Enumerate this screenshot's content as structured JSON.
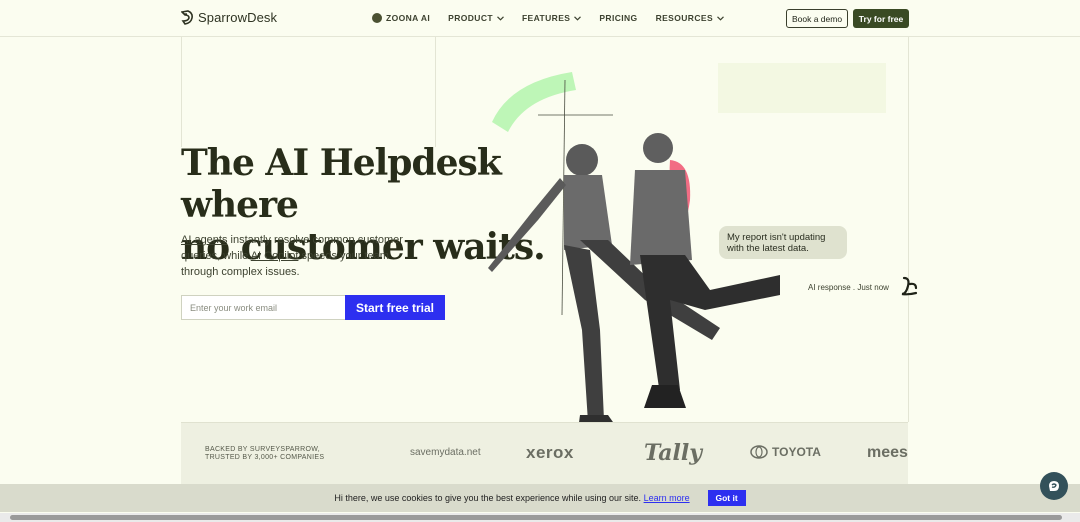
{
  "brand": {
    "name": "SparrowDesk"
  },
  "nav": {
    "items": [
      {
        "label": "ZOONA AI",
        "icon": "zoona-dot-icon"
      },
      {
        "label": "PRODUCT",
        "icon": "chevron-down-icon"
      },
      {
        "label": "FEATURES",
        "icon": "chevron-down-icon"
      },
      {
        "label": "PRICING"
      },
      {
        "label": "RESOURCES",
        "icon": "chevron-down-icon"
      }
    ],
    "book_demo": "Book a demo",
    "try_free": "Try for free"
  },
  "hero": {
    "title_line1": "The AI Helpdesk where",
    "title_line2": "no customer waits.",
    "sub_link1": "AI agents",
    "sub_part1": " instantly resolve common customer queries, while ",
    "sub_link2": "AI Copilot",
    "sub_part2": " speeds your team through complex issues.",
    "email_placeholder": "Enter your work email",
    "cta": "Start free trial"
  },
  "chat": {
    "message": "My report isn't updating with the latest data.",
    "ai_response": "AI response . Just now"
  },
  "logos": {
    "backed_line1": "BACKED BY SURVEYSPARROW,",
    "backed_line2": "TRUSTED BY 3,000+ COMPANIES",
    "brands": [
      "savemydata.net",
      "xerox",
      "Tally",
      "TOYOTA",
      "mees"
    ]
  },
  "cookie": {
    "text": "Hi there, we use cookies to give you the best experience while using our site.",
    "link": "Learn more",
    "button": "Got it"
  },
  "colors": {
    "background": "#fbfdf0",
    "accent_blue": "#2d2ff0",
    "dark_green": "#3a4a24",
    "mint_stroke": "#b7f5b0",
    "pink_stroke": "#f26d84"
  }
}
